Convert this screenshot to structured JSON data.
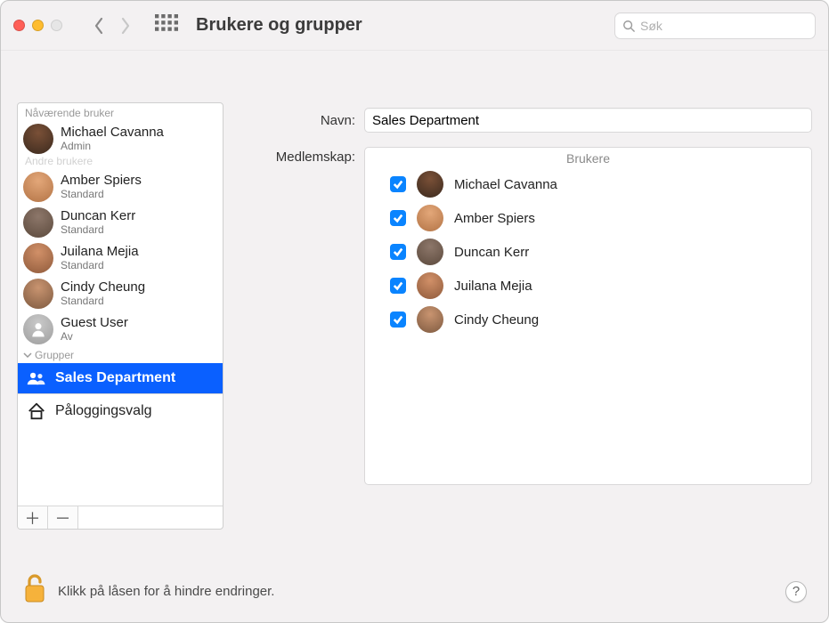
{
  "window": {
    "title": "Brukere og grupper"
  },
  "search": {
    "placeholder": "Søk",
    "value": ""
  },
  "sidebar": {
    "current_user_header": "Nåværende bruker",
    "other_users_header": "Andre brukere",
    "current_user": {
      "name": "Michael Cavanna",
      "role": "Admin"
    },
    "users": [
      {
        "name": "Amber Spiers",
        "role": "Standard"
      },
      {
        "name": "Duncan Kerr",
        "role": "Standard"
      },
      {
        "name": "Juilana Mejia",
        "role": "Standard"
      },
      {
        "name": "Cindy Cheung",
        "role": "Standard"
      },
      {
        "name": "Guest User",
        "role": "Av"
      }
    ],
    "groups_header": "Grupper",
    "group": "Sales Department",
    "login_options": "Påloggingsvalg"
  },
  "main": {
    "name_label": "Navn:",
    "name_value": "Sales Department",
    "membership_label": "Medlemskap:",
    "members_header": "Brukere",
    "members": [
      {
        "name": "Michael Cavanna",
        "checked": true
      },
      {
        "name": "Amber Spiers",
        "checked": true
      },
      {
        "name": "Duncan Kerr",
        "checked": true
      },
      {
        "name": "Juilana Mejia",
        "checked": true
      },
      {
        "name": "Cindy Cheung",
        "checked": true
      }
    ]
  },
  "footer": {
    "lock_text": "Klikk på låsen for å hindre endringer.",
    "help": "?"
  }
}
